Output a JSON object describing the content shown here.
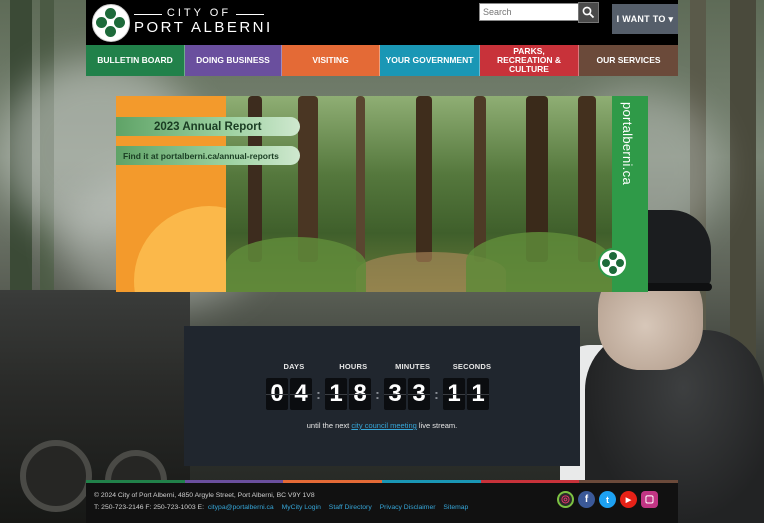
{
  "header": {
    "brand_top": "CITY OF",
    "brand_name": "PORT ALBERNI",
    "search_placeholder": "Search",
    "iwant_label": "I WANT TO ▾"
  },
  "nav": {
    "items": [
      {
        "label": "BULLETIN BOARD",
        "color": "#21814a"
      },
      {
        "label": "DOING BUSINESS",
        "color": "#6a4f9e"
      },
      {
        "label": "VISITING",
        "color": "#e46a36"
      },
      {
        "label": "YOUR GOVERNMENT",
        "color": "#1a97b5"
      },
      {
        "label": "PARKS, RECREATION & CULTURE",
        "color": "#c8323a"
      },
      {
        "label": "OUR SERVICES",
        "color": "#6b4a3a"
      }
    ]
  },
  "banner": {
    "ribbon_title": "2023 Annual Report",
    "ribbon_link": "Find it at portalberni.ca/annual-reports",
    "domain": "portalberni.ca"
  },
  "countdown": {
    "labels": [
      "DAYS",
      "HOURS",
      "MINUTES",
      "SECONDS"
    ],
    "days": [
      "0",
      "4"
    ],
    "hours": [
      "1",
      "8"
    ],
    "minutes": [
      "3",
      "3"
    ],
    "seconds": [
      "1",
      "1"
    ],
    "note_prefix": "until the next",
    "note_link": "city council meeting",
    "note_suffix": "live stream."
  },
  "footer": {
    "line1": "© 2024 City of Port Alberni, 4850 Argyle Street, Port Alberni, BC  V9Y 1V8",
    "line2_phones": "T: 250-723-2146    F: 250-723-1003    E:",
    "email": "citypa@portalberni.ca",
    "links": [
      "MyCity Login",
      "Staff Directory",
      "Privacy Disclaimer",
      "Sitemap"
    ],
    "socials": [
      {
        "name": "podcast-icon",
        "glyph": "◎",
        "color": "#2a2a2a"
      },
      {
        "name": "facebook-icon",
        "glyph": "f",
        "color": "#3b5998"
      },
      {
        "name": "twitter-icon",
        "glyph": "t",
        "color": "#1da1f2"
      },
      {
        "name": "youtube-icon",
        "glyph": "▶",
        "color": "#e62117"
      },
      {
        "name": "instagram-icon",
        "glyph": "▢",
        "color": "#c13584"
      }
    ]
  }
}
